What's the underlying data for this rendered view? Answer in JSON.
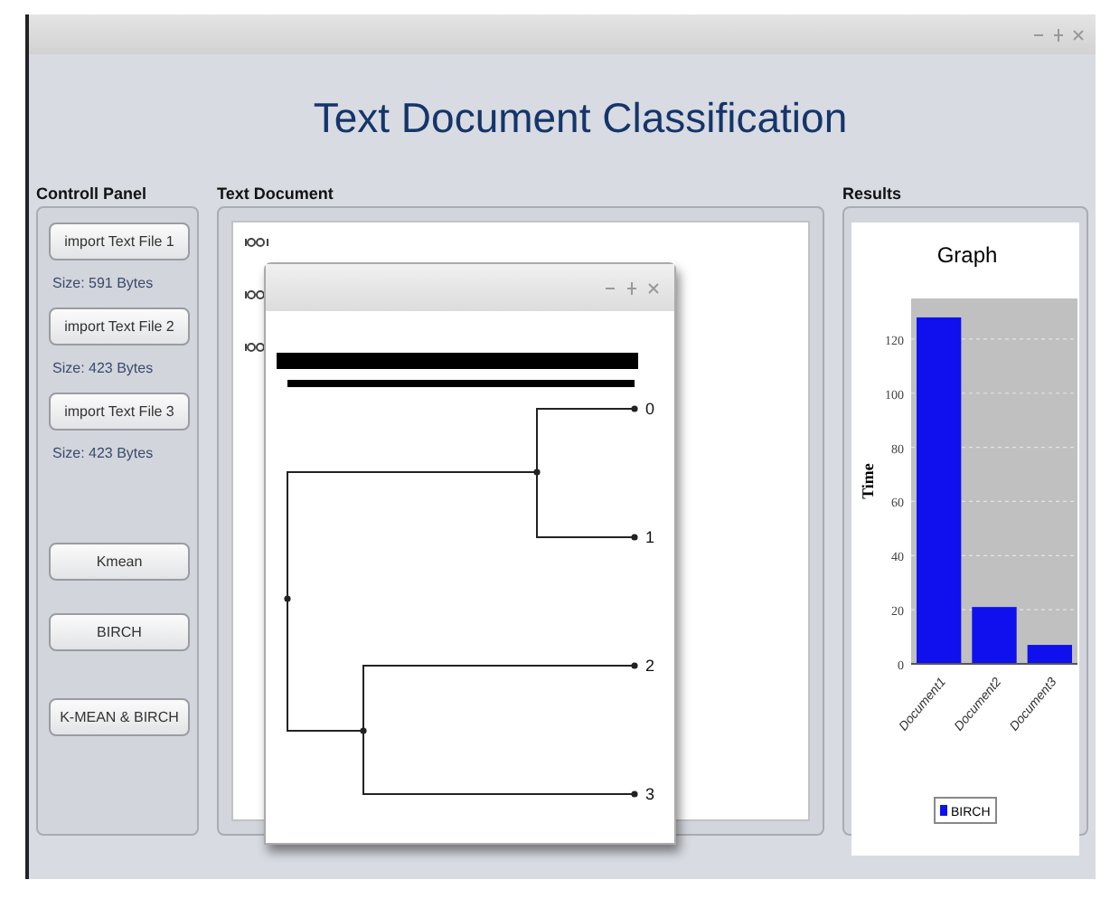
{
  "window": {
    "title": "Text Document Classification"
  },
  "control_panel": {
    "label": "Controll Panel",
    "imports": [
      {
        "button": "import Text File 1",
        "size": "Size: 591 Bytes"
      },
      {
        "button": "import Text File 2",
        "size": "Size: 423 Bytes"
      },
      {
        "button": "import Text File 3",
        "size": "Size: 423 Bytes"
      }
    ],
    "algorithm_buttons": [
      "Kmean",
      "BIRCH",
      "K-MEAN & BIRCH"
    ]
  },
  "text_document": {
    "label": "Text Document"
  },
  "dendrogram_window": {
    "leaves": [
      "0",
      "1",
      "2",
      "3"
    ]
  },
  "results": {
    "label": "Results",
    "chart_data": {
      "type": "bar",
      "title": "Graph",
      "ylabel": "Time",
      "categories": [
        "Document1",
        "Document2",
        "Document3"
      ],
      "series": [
        {
          "name": "BIRCH",
          "color": "#1010ee",
          "values": [
            128,
            21,
            7
          ]
        }
      ],
      "ylim": [
        0,
        135
      ],
      "yticks": [
        0,
        20,
        40,
        60,
        80,
        100,
        120
      ],
      "grid": true
    }
  }
}
